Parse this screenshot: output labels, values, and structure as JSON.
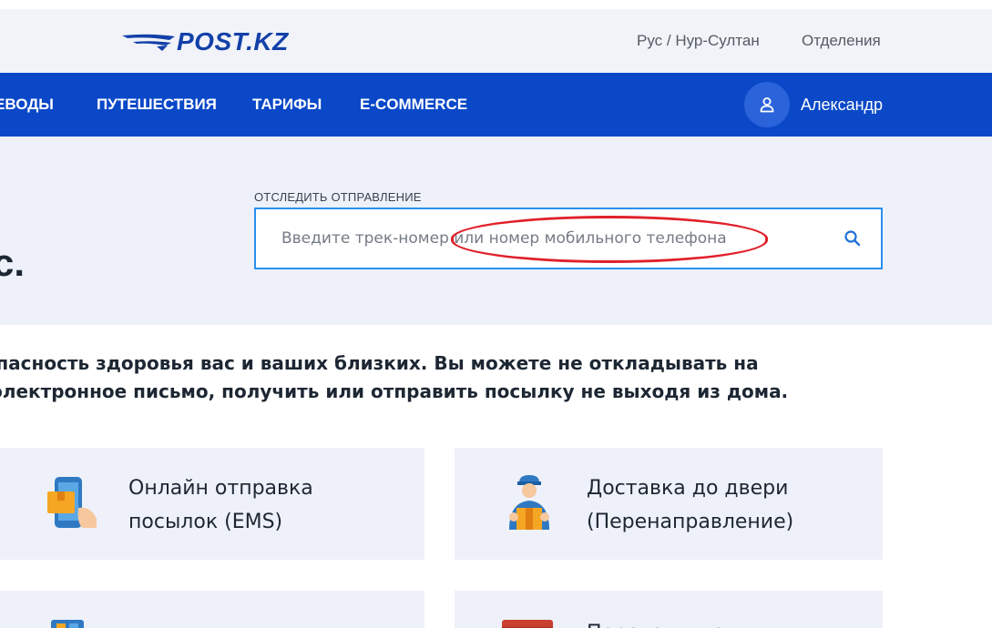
{
  "header": {
    "logo_text": "POST.KZ",
    "language_city": "Рус / Нур-Султан",
    "branches_link": "Отделения"
  },
  "nav": {
    "items": [
      {
        "label": "ЕВОДЫ"
      },
      {
        "label": "ПУТЕШЕСТВИЯ"
      },
      {
        "label": "ТАРИФЫ"
      },
      {
        "label": "E-COMMERCE"
      }
    ],
    "user_name": "Александр"
  },
  "hero": {
    "partial_heading": "с.",
    "track_label": "ОТСЛЕДИТЬ ОТПРАВЛЕНИЕ",
    "track_placeholder": "Введите трек-номер или номер мобильного телефона"
  },
  "intro": {
    "line1": "зопасность здоровья вас и ваших близких. Вы можете не откладывать на",
    "line2": "и электронное письмо, получить или отправить посылку не выходя из дома."
  },
  "cards": [
    {
      "title_line1": "Онлайн отправка",
      "title_line2": "посылок (EMS)",
      "icon": "phone-parcel-icon"
    },
    {
      "title_line1": "Доставка до двери",
      "title_line2": "(Перенаправление)",
      "icon": "courier-icon"
    },
    {
      "title_line1": "",
      "title_line2": "",
      "icon": "card-icon"
    },
    {
      "title_line1": "Переводы по",
      "title_line2": "",
      "icon": "transfer-icon"
    }
  ],
  "colors": {
    "brand_blue": "#0a48c8",
    "header_bg": "#f1f3f9",
    "hero_bg": "#eef1f9",
    "input_border": "#2a8ff0",
    "annotation_red": "#e0202a"
  }
}
